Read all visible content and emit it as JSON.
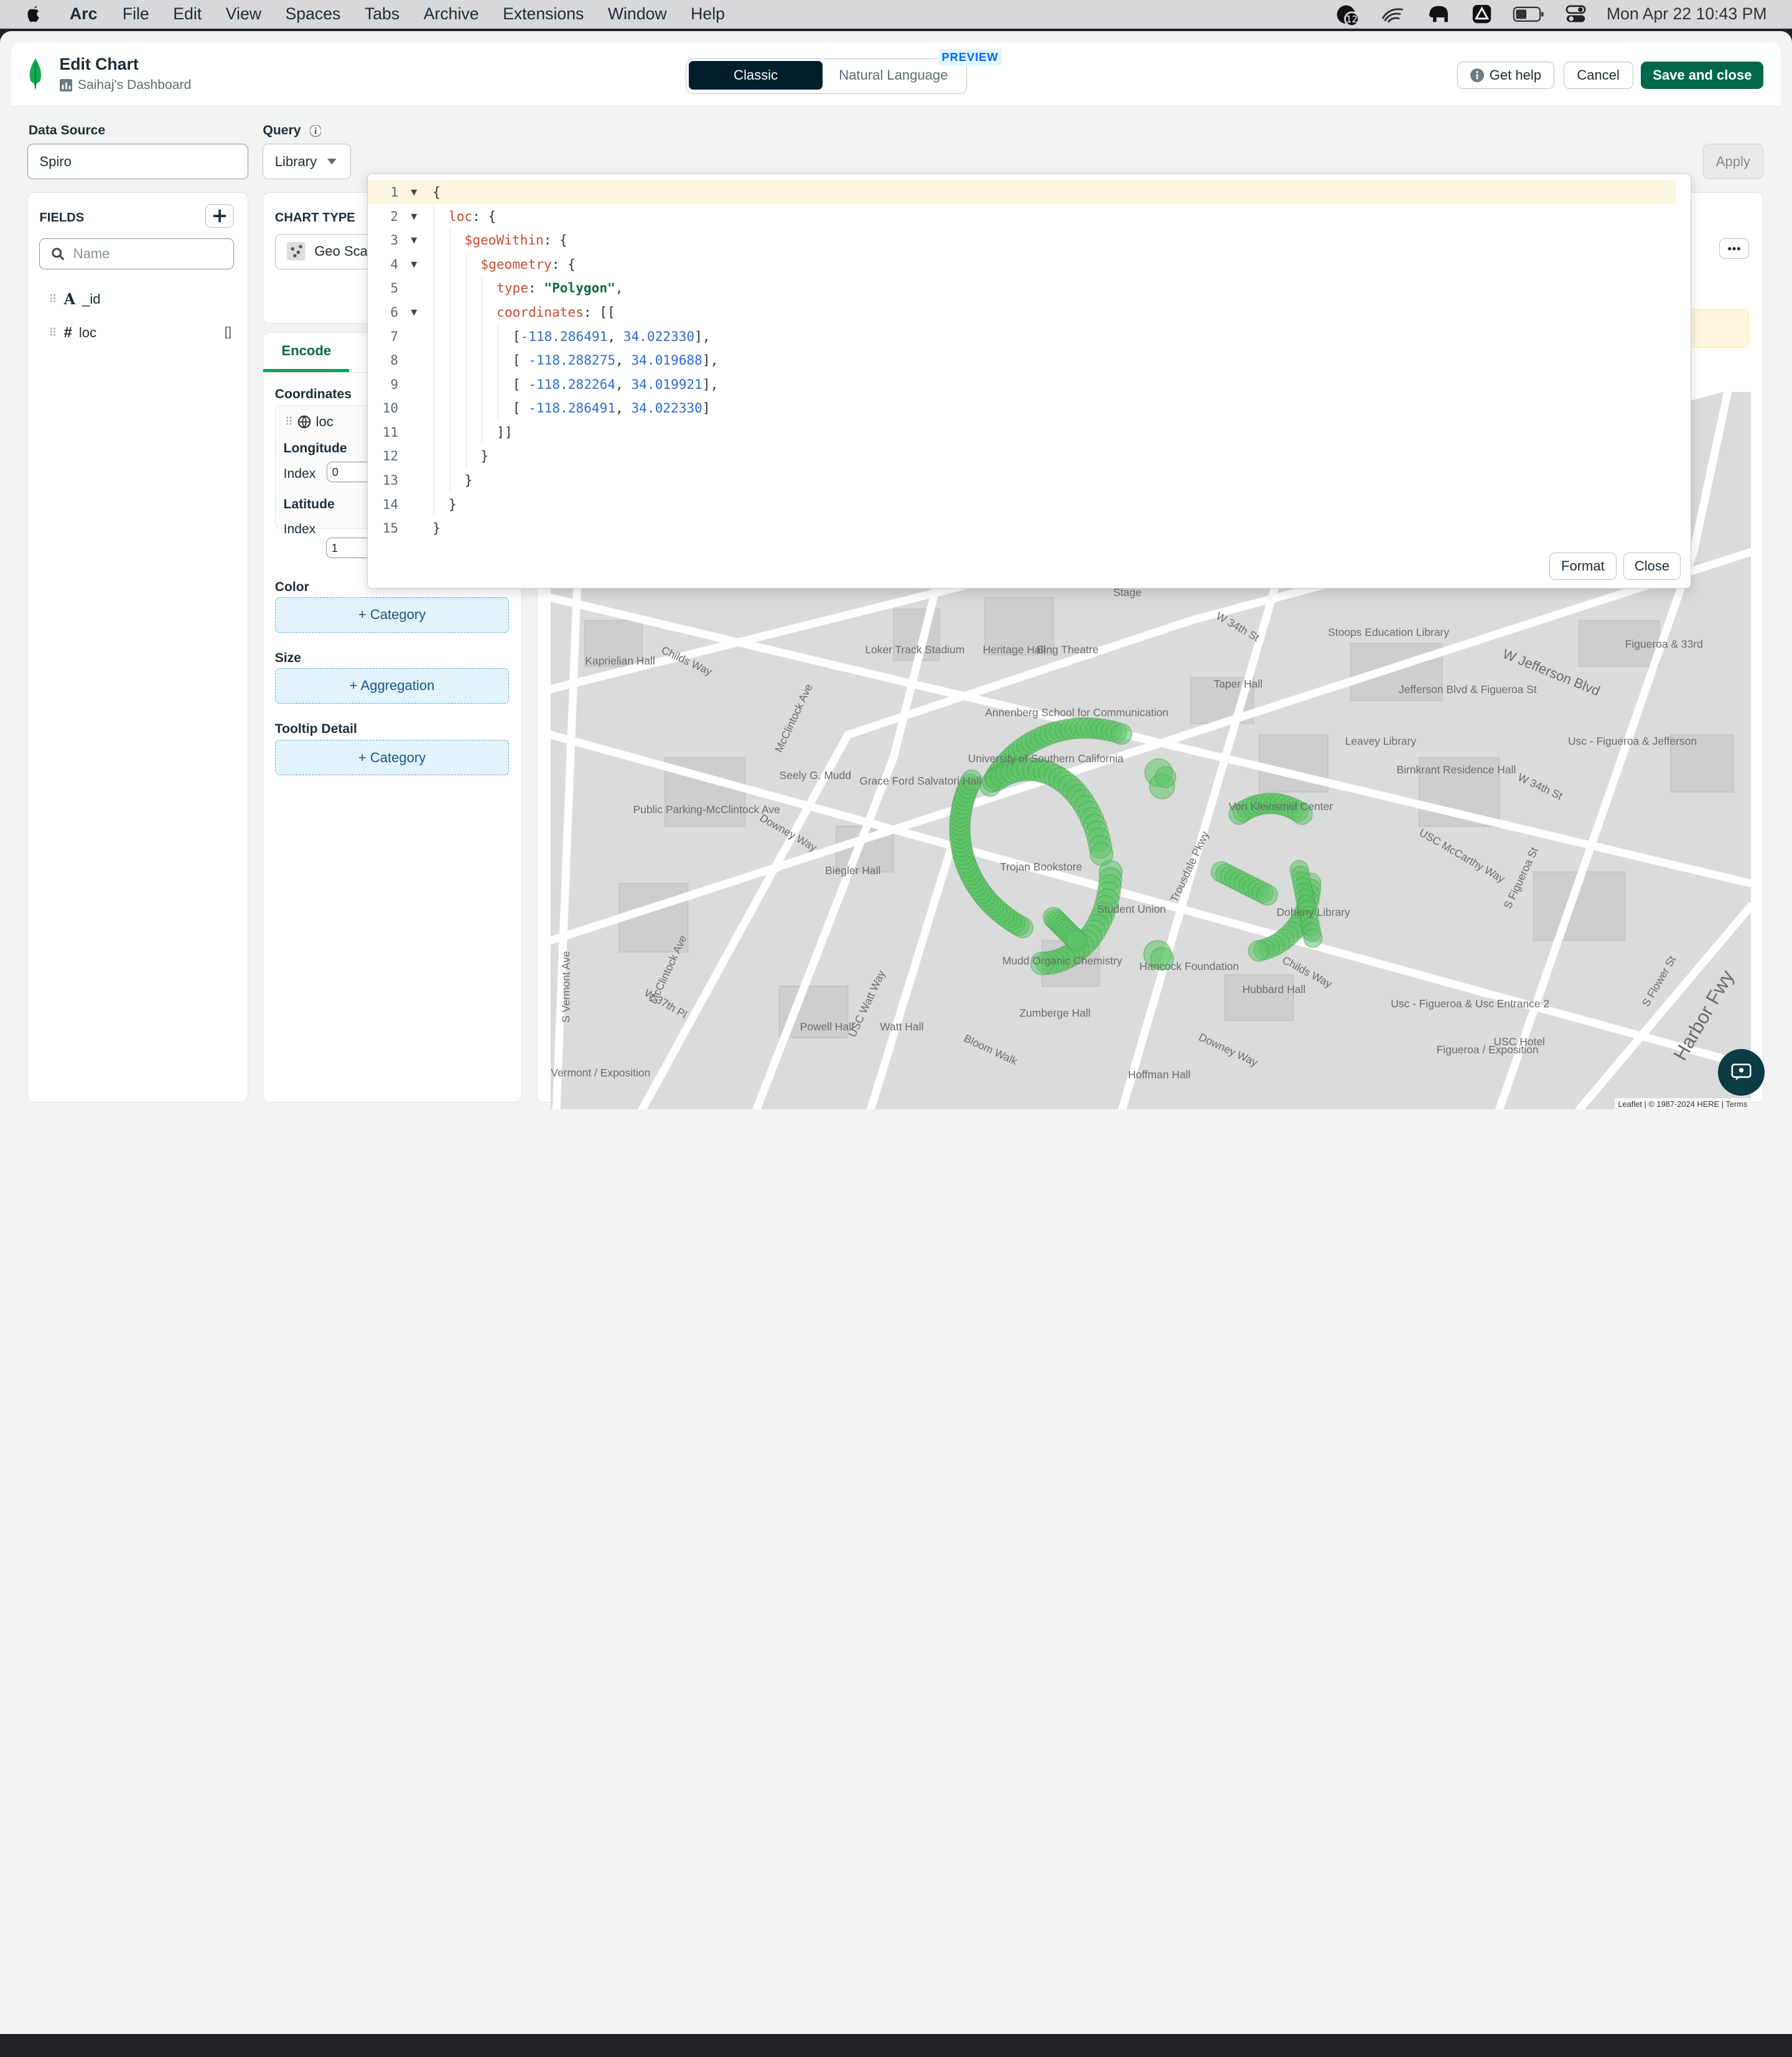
{
  "menubar": {
    "app": "Arc",
    "items": [
      "File",
      "Edit",
      "View",
      "Spaces",
      "Tabs",
      "Archive",
      "Extensions",
      "Window",
      "Help"
    ],
    "clock": "Mon Apr 22  10:43 PM",
    "badge_count": "12"
  },
  "header": {
    "title": "Edit Chart",
    "dashboard": "Saihaj's Dashboard",
    "modes": [
      "Classic",
      "Natural Language"
    ],
    "preview_badge": "PREVIEW",
    "get_help": "Get help",
    "cancel": "Cancel",
    "save": "Save and close"
  },
  "data_source": {
    "label": "Data Source",
    "value": "Spiro"
  },
  "query": {
    "label": "Query",
    "mode": "Library",
    "apply": "Apply"
  },
  "fields": {
    "title": "FIELDS",
    "search_placeholder": "Name",
    "items": [
      {
        "type": "A",
        "name": "_id"
      },
      {
        "type": "#",
        "name": "loc",
        "suffix": "[]"
      }
    ]
  },
  "chart_type": {
    "title": "CHART TYPE",
    "value": "Geo Scatter"
  },
  "encode": {
    "tab": "Encode",
    "coordinates": "Coordinates",
    "field": "loc",
    "longitude": "Longitude",
    "latitude": "Latitude",
    "index_label": "Index",
    "longitude_index": "0",
    "latitude_index": "1",
    "color": "Color",
    "color_drop": "+ Category",
    "size": "Size",
    "size_drop": "+ Aggregation",
    "tooltip": "Tooltip Detail",
    "tooltip_drop": "+ Category"
  },
  "editor": {
    "format": "Format",
    "close": "Close",
    "lines": [
      {
        "n": "1",
        "fold": true,
        "indent": 0,
        "tokens": [
          [
            "p",
            "{"
          ]
        ]
      },
      {
        "n": "2",
        "fold": true,
        "indent": 1,
        "tokens": [
          [
            "k",
            "loc"
          ],
          [
            "p",
            ": {"
          ]
        ]
      },
      {
        "n": "3",
        "fold": true,
        "indent": 2,
        "tokens": [
          [
            "k",
            "$geoWithin"
          ],
          [
            "p",
            ": {"
          ]
        ]
      },
      {
        "n": "4",
        "fold": true,
        "indent": 3,
        "tokens": [
          [
            "k",
            "$geometry"
          ],
          [
            "p",
            ": {"
          ]
        ]
      },
      {
        "n": "5",
        "fold": false,
        "indent": 4,
        "tokens": [
          [
            "k",
            "type"
          ],
          [
            "p",
            ": "
          ],
          [
            "s",
            "\"Polygon\""
          ],
          [
            "p",
            ","
          ]
        ]
      },
      {
        "n": "6",
        "fold": true,
        "indent": 4,
        "tokens": [
          [
            "k",
            "coordinates"
          ],
          [
            "p",
            ": [["
          ]
        ]
      },
      {
        "n": "7",
        "fold": false,
        "indent": 5,
        "tokens": [
          [
            "p",
            "["
          ],
          [
            "n",
            "-118.286491"
          ],
          [
            "p",
            ", "
          ],
          [
            "n",
            "34.022330"
          ],
          [
            "p",
            "],"
          ]
        ]
      },
      {
        "n": "8",
        "fold": false,
        "indent": 5,
        "tokens": [
          [
            "p",
            "[ "
          ],
          [
            "n",
            "-118.288275"
          ],
          [
            "p",
            ", "
          ],
          [
            "n",
            "34.019688"
          ],
          [
            "p",
            "],"
          ]
        ]
      },
      {
        "n": "9",
        "fold": false,
        "indent": 5,
        "tokens": [
          [
            "p",
            "[ "
          ],
          [
            "n",
            "-118.282264"
          ],
          [
            "p",
            ", "
          ],
          [
            "n",
            "34.019921"
          ],
          [
            "p",
            "],"
          ]
        ]
      },
      {
        "n": "10",
        "fold": false,
        "indent": 5,
        "tokens": [
          [
            "p",
            "[ "
          ],
          [
            "n",
            "-118.286491"
          ],
          [
            "p",
            ", "
          ],
          [
            "n",
            "34.022330"
          ],
          [
            "p",
            "]"
          ]
        ]
      },
      {
        "n": "11",
        "fold": false,
        "indent": 4,
        "tokens": [
          [
            "p",
            "]]"
          ]
        ]
      },
      {
        "n": "12",
        "fold": false,
        "indent": 3,
        "tokens": [
          [
            "p",
            "}"
          ]
        ]
      },
      {
        "n": "13",
        "fold": false,
        "indent": 2,
        "tokens": [
          [
            "p",
            "}"
          ]
        ]
      },
      {
        "n": "14",
        "fold": false,
        "indent": 1,
        "tokens": [
          [
            "p",
            "}"
          ]
        ]
      },
      {
        "n": "15",
        "fold": false,
        "indent": 0,
        "tokens": [
          [
            "p",
            "}"
          ]
        ]
      }
    ]
  },
  "map": {
    "attribution": "Leaflet | © 1987-2024 HERE | Terms",
    "labels": [
      "Stage",
      "W 34th St",
      "Stoops Education Library",
      "W Jefferson Blvd",
      "Figueroa & 33rd",
      "Kaprielian Hall",
      "Childs Way",
      "Loker Track Stadium",
      "Heritage Hall",
      "Bing Theatre",
      "Taper Hall",
      "Jefferson Blvd & Figueroa St",
      "Annenberg School for Communication",
      "Leavey Library",
      "Usc - Figueroa & Jefferson",
      "McClintock Ave",
      "University of Southern California",
      "Birnkrant Residence Hall",
      "W 34th St",
      "Seely G. Mudd",
      "Grace Ford Salvatori Hall",
      "Public Parking-McClintock Ave",
      "Downey Way",
      "Von Kleinsmid Center",
      "Trousdale Pkwy",
      "USC McCarthy Way",
      "S Figueroa St",
      "Biegler Hall",
      "Trojan Bookstore",
      "Doheny Library",
      "Student Union",
      "S Vermont Ave",
      "McClintock Ave",
      "Mudd Organic Chemistry",
      "Hancock Foundation",
      "Childs Way",
      "Hubbard Hall",
      "S Flower St",
      "Harbor Fwy",
      "W 37th Pl",
      "USC Watt Way",
      "Powell Hall",
      "Watt Hall",
      "Zumberge Hall",
      "Usc - Figueroa & Usc Entrance 2",
      "Bloom Walk",
      "Downey Way",
      "USC Hotel",
      "Hoffman Hall",
      "Figueroa / Exposition",
      "Vermont / Exposition"
    ],
    "point_color": "#5cc466"
  }
}
